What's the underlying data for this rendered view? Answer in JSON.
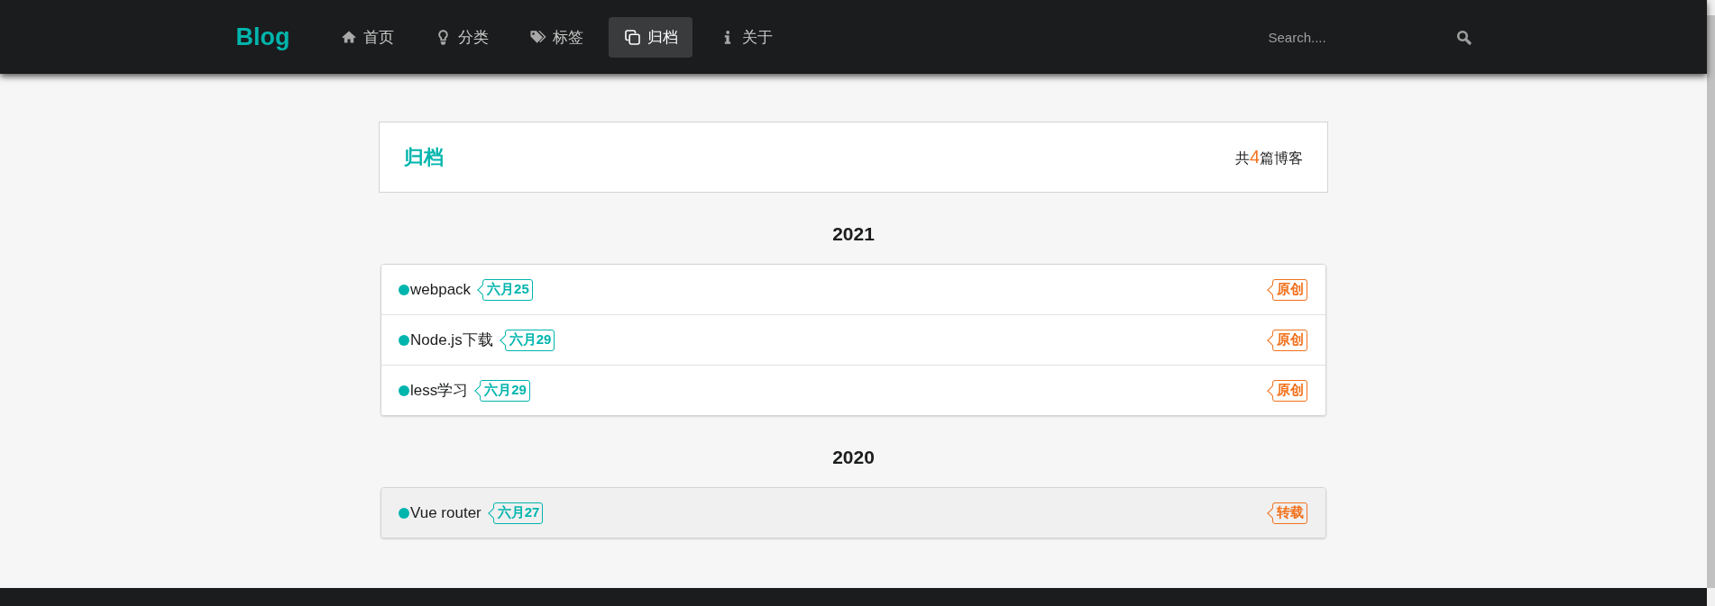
{
  "navbar": {
    "logo": "Blog",
    "menu": [
      {
        "kind": "home",
        "label": "首页",
        "selected": false
      },
      {
        "kind": "bulb",
        "label": "分类",
        "selected": false
      },
      {
        "kind": "tags",
        "label": "标签",
        "selected": false
      },
      {
        "kind": "copy",
        "label": "归档",
        "selected": true
      },
      {
        "kind": "info",
        "label": "关于",
        "selected": false
      }
    ],
    "search": {
      "placeholder": "Search...."
    }
  },
  "archive_header": {
    "title": "归档",
    "count_prefix": "共",
    "count": "4",
    "count_suffix": "篇博客"
  },
  "years": [
    {
      "year": "2021",
      "posts": [
        {
          "title": "webpack",
          "date": "六月25",
          "type": "原创",
          "highlighted": false
        },
        {
          "title": "Node.js下载",
          "date": "六月29",
          "type": "原创",
          "highlighted": false
        },
        {
          "title": "less学习",
          "date": "六月29",
          "type": "原创",
          "highlighted": false
        }
      ]
    },
    {
      "year": "2020",
      "posts": [
        {
          "title": "Vue router",
          "date": "六月27",
          "type": "转载",
          "highlighted": true
        }
      ]
    }
  ]
}
